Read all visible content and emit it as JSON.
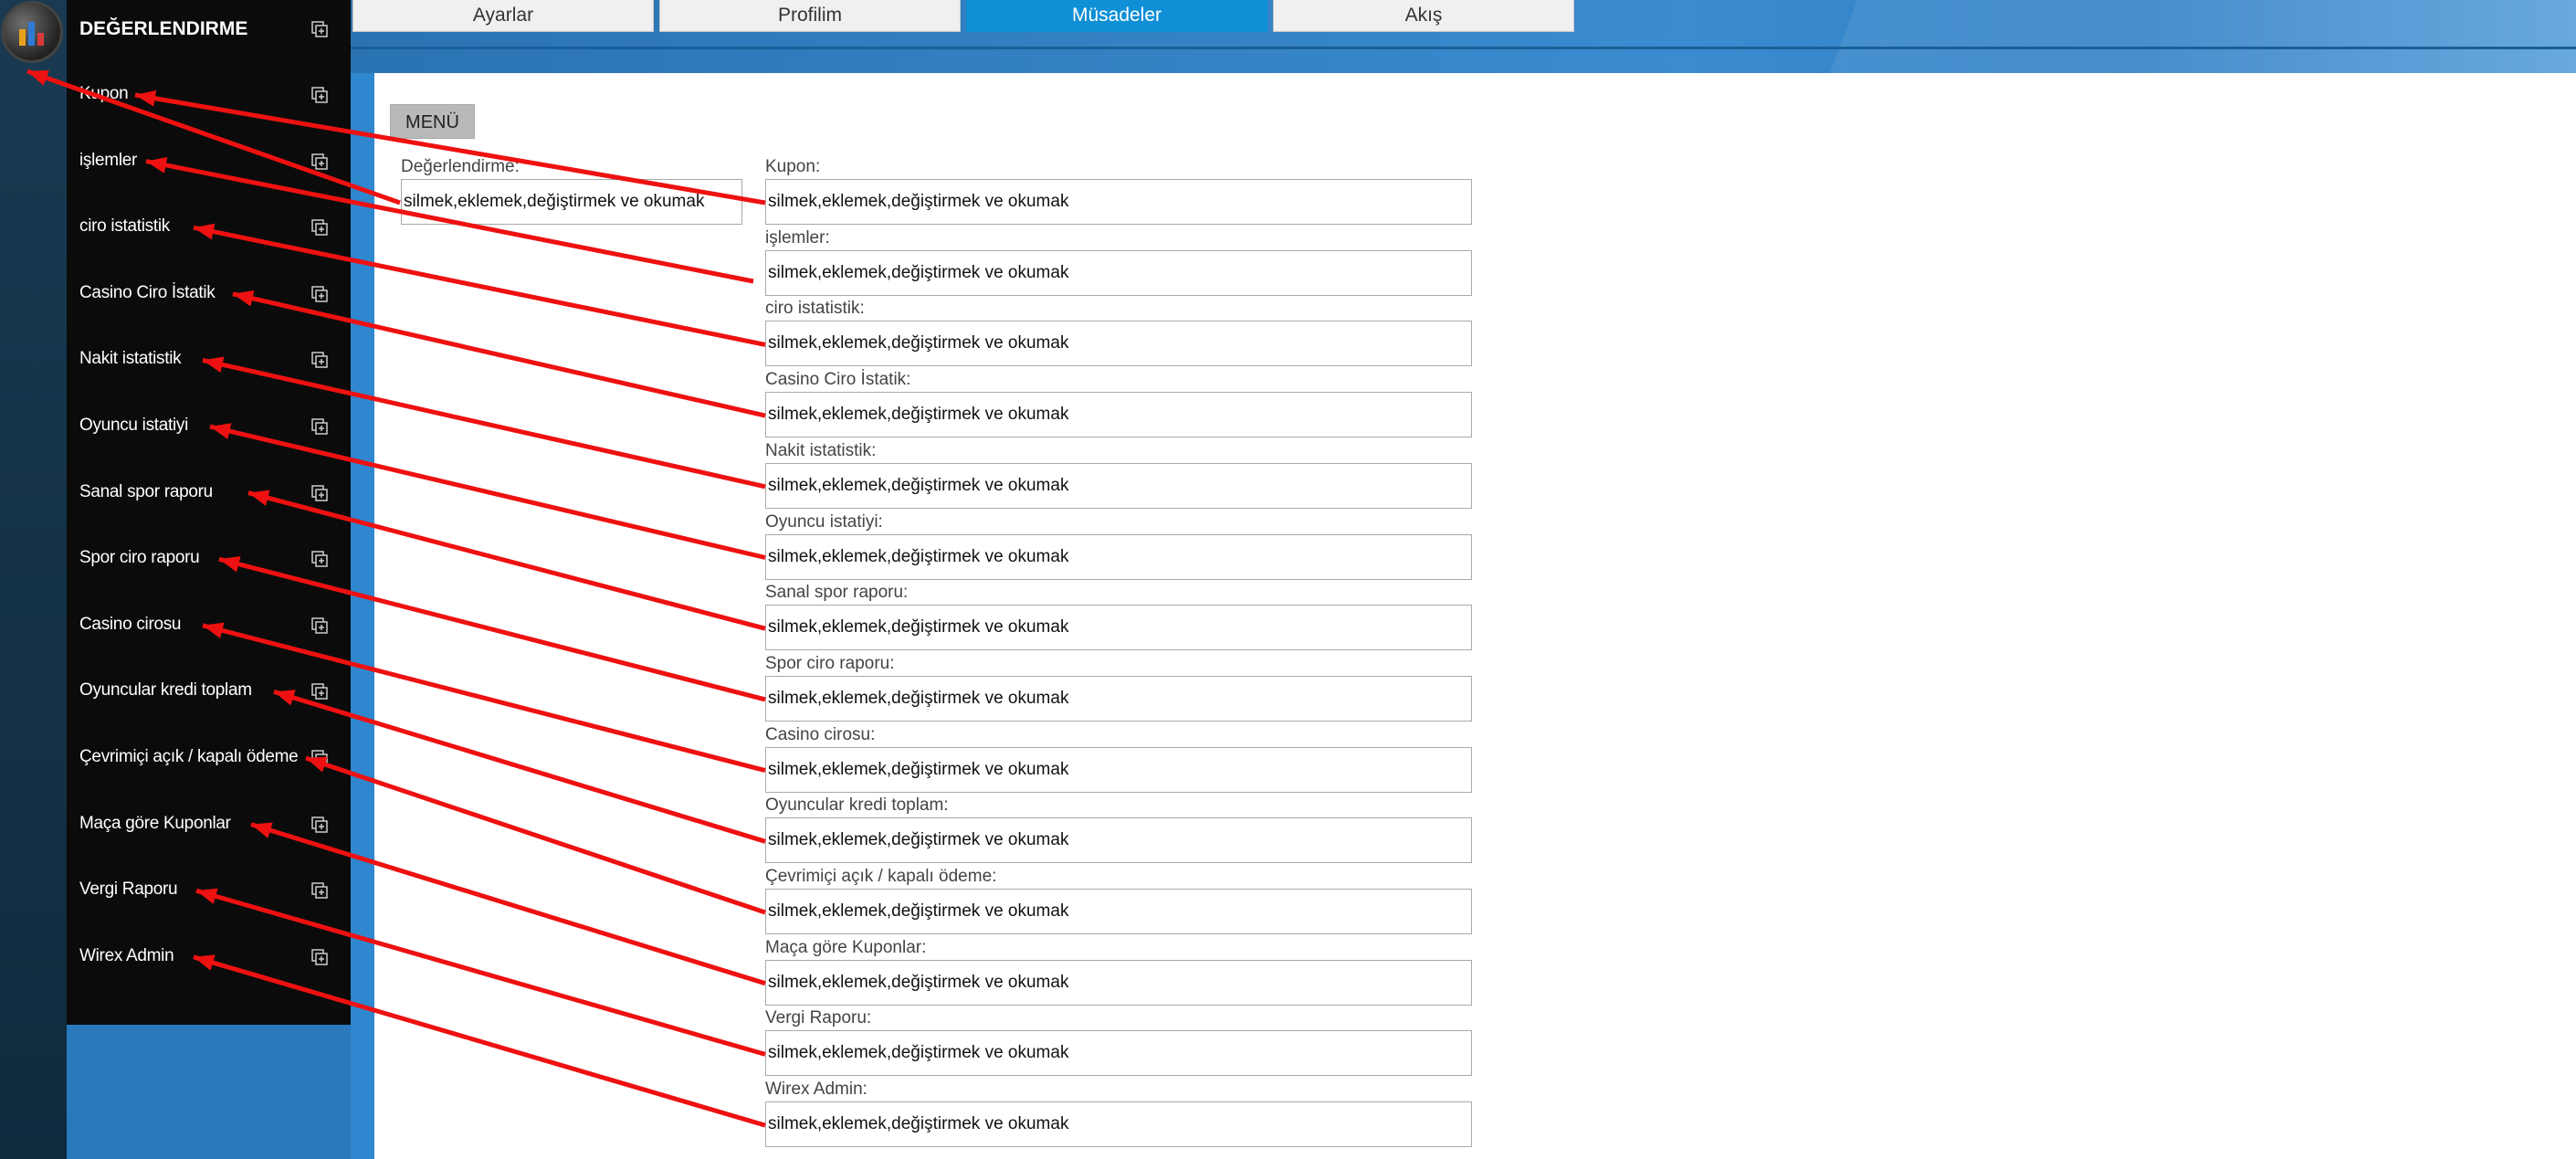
{
  "sidebar": {
    "title": "DEĞERLENDIRME",
    "items": [
      {
        "label": "Kupon"
      },
      {
        "label": "işlemler"
      },
      {
        "label": "ciro istatistik"
      },
      {
        "label": "Casino Ciro İstatik"
      },
      {
        "label": "Nakit istatistik"
      },
      {
        "label": "Oyuncu istatiyi"
      },
      {
        "label": "Sanal spor raporu"
      },
      {
        "label": "Spor ciro raporu"
      },
      {
        "label": "Casino cirosu"
      },
      {
        "label": "Oyuncular kredi toplam"
      },
      {
        "label": "Çevrimiçi açık / kapalı ödeme"
      },
      {
        "label": "Maça göre Kuponlar"
      },
      {
        "label": "Vergi Raporu"
      },
      {
        "label": "Wirex Admin"
      }
    ]
  },
  "tabs": [
    {
      "label": "Ayarlar",
      "active": false
    },
    {
      "label": "Profilim",
      "active": false
    },
    {
      "label": "Müsadeler",
      "active": true
    },
    {
      "label": "Akış",
      "active": false
    }
  ],
  "main": {
    "menu_button": "MENÜ",
    "main_field": {
      "label": "Değerlendirme:",
      "value": "silmek,eklemek,değiştirmek ve okumak"
    },
    "fields": [
      {
        "label": "Kupon:",
        "value": "silmek,eklemek,değiştirmek ve okumak"
      },
      {
        "label": "işlemler:",
        "value": "silmek,eklemek,değiştirmek ve okumak"
      },
      {
        "label": "ciro istatistik:",
        "value": "silmek,eklemek,değiştirmek ve okumak"
      },
      {
        "label": "Casino Ciro İstatik:",
        "value": "silmek,eklemek,değiştirmek ve okumak"
      },
      {
        "label": "Nakit istatistik:",
        "value": "silmek,eklemek,değiştirmek ve okumak"
      },
      {
        "label": "Oyuncu istatiyi:",
        "value": "silmek,eklemek,değiştirmek ve okumak"
      },
      {
        "label": "Sanal spor raporu:",
        "value": "silmek,eklemek,değiştirmek ve okumak"
      },
      {
        "label": "Spor ciro raporu:",
        "value": "silmek,eklemek,değiştirmek ve okumak"
      },
      {
        "label": "Casino cirosu:",
        "value": "silmek,eklemek,değiştirmek ve okumak"
      },
      {
        "label": "Oyuncular kredi toplam:",
        "value": "silmek,eklemek,değiştirmek ve okumak"
      },
      {
        "label": "Çevrimiçi açık / kapalı ödeme:",
        "value": "silmek,eklemek,değiştirmek ve okumak"
      },
      {
        "label": "Maça göre Kuponlar:",
        "value": "silmek,eklemek,değiştirmek ve okumak"
      },
      {
        "label": "Vergi Raporu:",
        "value": "silmek,eklemek,değiştirmek ve okumak"
      },
      {
        "label": "Wirex Admin:",
        "value": "silmek,eklemek,değiştirmek ve okumak"
      }
    ]
  },
  "colors": {
    "arrow": "#ee1111",
    "active_tab": "#0f8fd6",
    "sidebar_bg": "#0b0b0b",
    "header_blue": "#2a79bd"
  },
  "icons": {
    "logo": "chart-logo-icon",
    "expand": "expand-square-icon"
  }
}
